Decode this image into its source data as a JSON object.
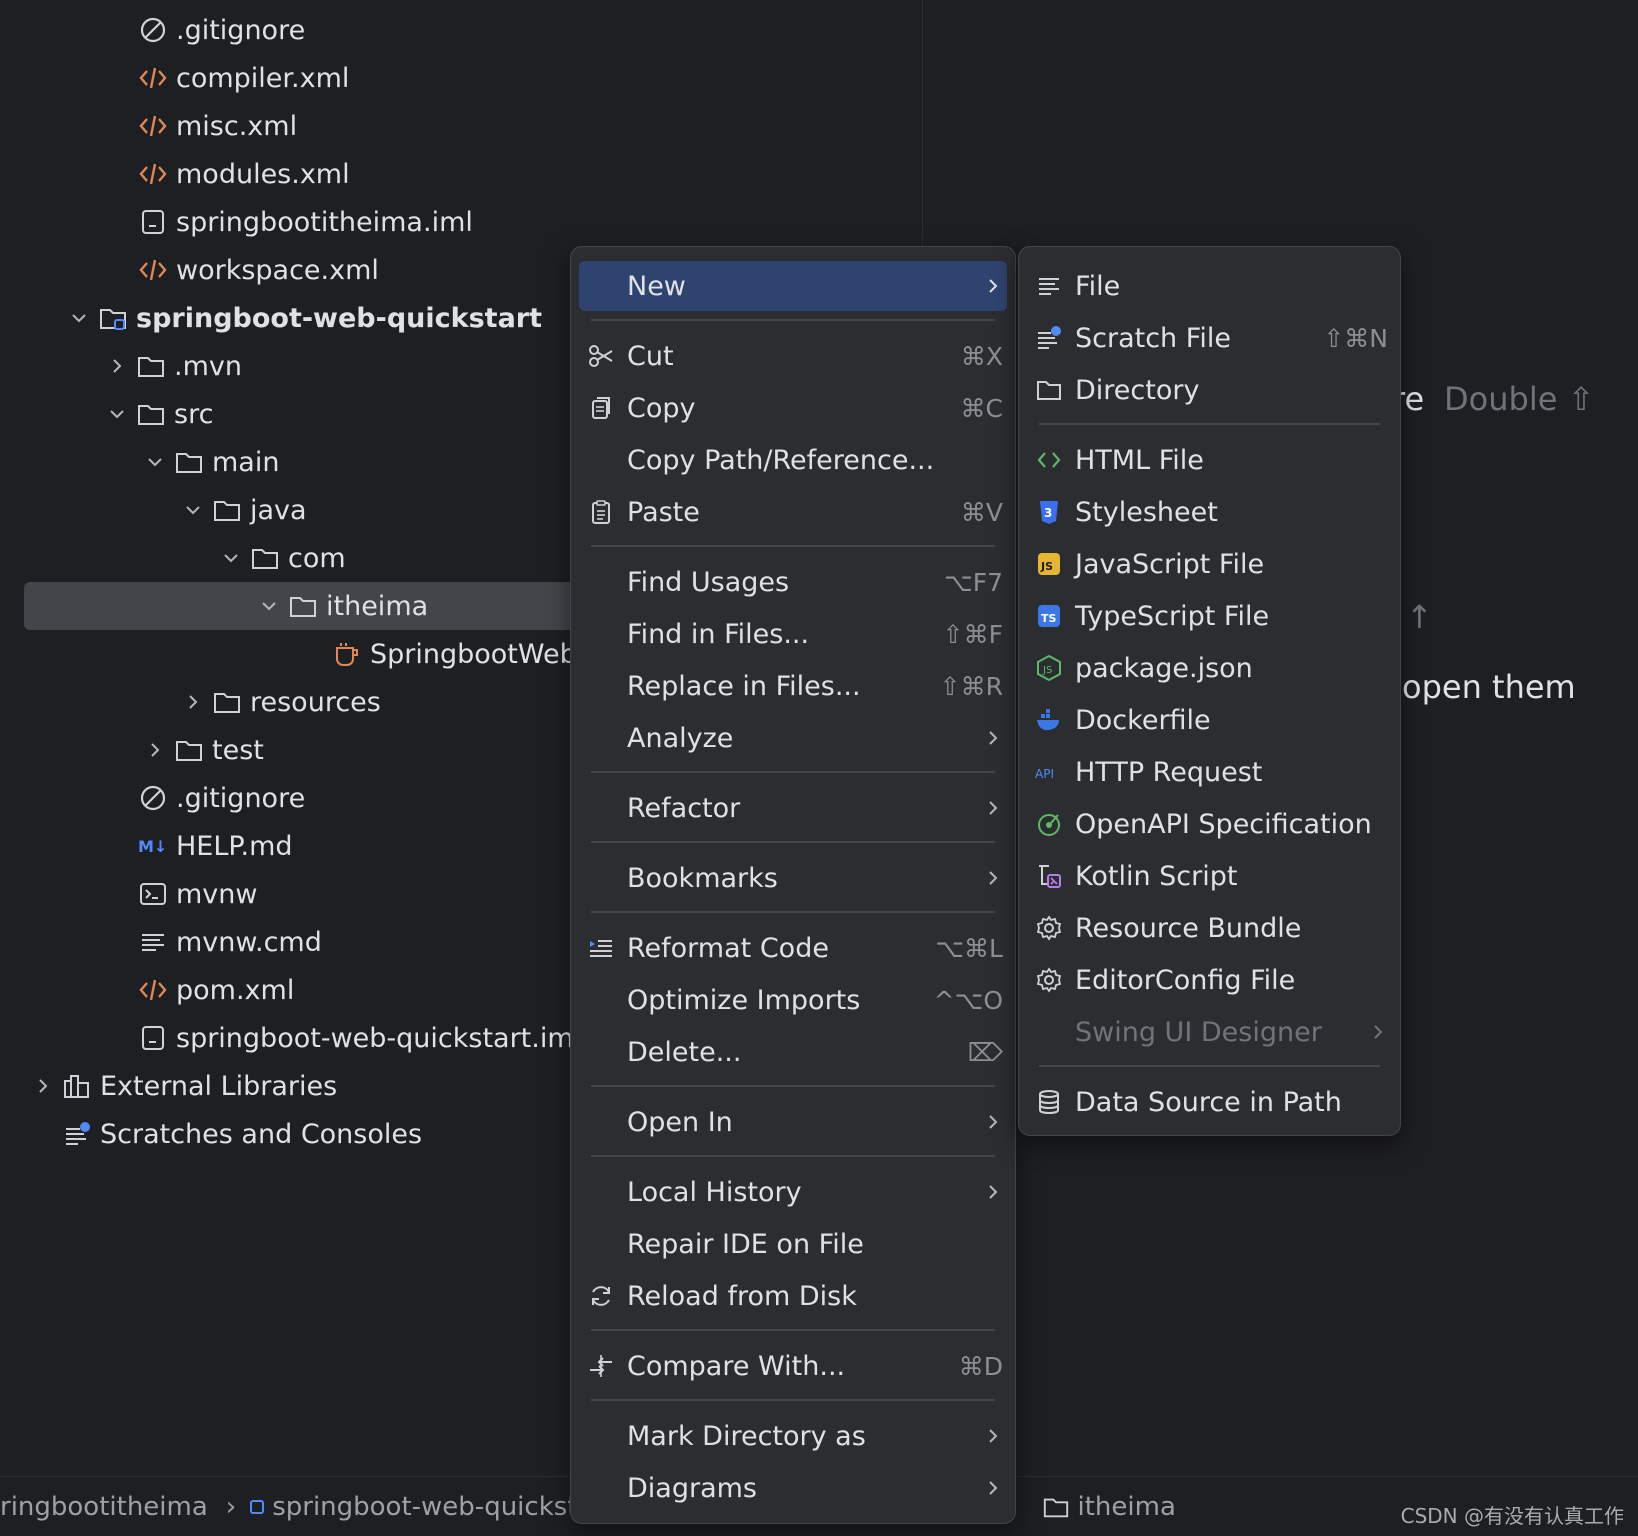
{
  "tree": [
    {
      "label": ".gitignore",
      "icon": "ignore-icon",
      "chevron": ""
    },
    {
      "label": "compiler.xml",
      "icon": "xml-icon",
      "chevron": ""
    },
    {
      "label": "misc.xml",
      "icon": "xml-icon",
      "chevron": ""
    },
    {
      "label": "modules.xml",
      "icon": "xml-icon",
      "chevron": ""
    },
    {
      "label": "springbootitheima.iml",
      "icon": "iml-icon",
      "chevron": ""
    },
    {
      "label": "workspace.xml",
      "icon": "xml-icon",
      "chevron": ""
    },
    {
      "label": "springboot-web-quickstart",
      "icon": "module-folder-icon",
      "chevron": "down"
    },
    {
      "label": ".mvn",
      "icon": "folder-icon",
      "chevron": "right"
    },
    {
      "label": "src",
      "icon": "folder-icon",
      "chevron": "down"
    },
    {
      "label": "main",
      "icon": "folder-icon",
      "chevron": "down"
    },
    {
      "label": "java",
      "icon": "folder-icon",
      "chevron": "down"
    },
    {
      "label": "com",
      "icon": "folder-icon",
      "chevron": "down"
    },
    {
      "label": "itheima",
      "icon": "folder-icon",
      "chevron": "down"
    },
    {
      "label": "SpringbootWebQ",
      "icon": "java-class-icon",
      "chevron": ""
    },
    {
      "label": "resources",
      "icon": "folder-icon",
      "chevron": "right"
    },
    {
      "label": "test",
      "icon": "folder-icon",
      "chevron": "right"
    },
    {
      "label": ".gitignore",
      "icon": "ignore-icon",
      "chevron": ""
    },
    {
      "label": "HELP.md",
      "icon": "markdown-icon",
      "chevron": ""
    },
    {
      "label": "mvnw",
      "icon": "terminal-icon",
      "chevron": ""
    },
    {
      "label": "mvnw.cmd",
      "icon": "text-file-icon",
      "chevron": ""
    },
    {
      "label": "pom.xml",
      "icon": "xml-icon",
      "chevron": ""
    },
    {
      "label": "springboot-web-quickstart.iml",
      "icon": "iml-icon",
      "chevron": ""
    },
    {
      "label": "External Libraries",
      "icon": "library-icon",
      "chevron": "right"
    },
    {
      "label": "Scratches and Consoles",
      "icon": "scratches-icon",
      "chevron": ""
    }
  ],
  "editor_hints": {
    "search_fragment": "re",
    "search_shortcut": "Double ⇧",
    "up_arrow": "↑",
    "open_fragment": "open them"
  },
  "context_menu": {
    "items": [
      {
        "label": "New",
        "shortcut": "",
        "icon": "",
        "submenu": true
      },
      {
        "label": "Cut",
        "shortcut": "⌘X",
        "icon": "scissors-icon",
        "submenu": false
      },
      {
        "label": "Copy",
        "shortcut": "⌘C",
        "icon": "copy-icon",
        "submenu": false
      },
      {
        "label": "Copy Path/Reference...",
        "shortcut": "",
        "icon": "",
        "submenu": false
      },
      {
        "label": "Paste",
        "shortcut": "⌘V",
        "icon": "clipboard-icon",
        "submenu": false
      },
      {
        "label": "Find Usages",
        "shortcut": "⌥F7",
        "icon": "",
        "submenu": false
      },
      {
        "label": "Find in Files...",
        "shortcut": "⇧⌘F",
        "icon": "",
        "submenu": false
      },
      {
        "label": "Replace in Files...",
        "shortcut": "⇧⌘R",
        "icon": "",
        "submenu": false
      },
      {
        "label": "Analyze",
        "shortcut": "",
        "icon": "",
        "submenu": true
      },
      {
        "label": "Refactor",
        "shortcut": "",
        "icon": "",
        "submenu": true
      },
      {
        "label": "Bookmarks",
        "shortcut": "",
        "icon": "",
        "submenu": true
      },
      {
        "label": "Reformat Code",
        "shortcut": "⌥⌘L",
        "icon": "reformat-icon",
        "submenu": false
      },
      {
        "label": "Optimize Imports",
        "shortcut": "^⌥O",
        "icon": "",
        "submenu": false
      },
      {
        "label": "Delete...",
        "shortcut": "⌦",
        "icon": "",
        "submenu": false
      },
      {
        "label": "Open In",
        "shortcut": "",
        "icon": "",
        "submenu": true
      },
      {
        "label": "Local History",
        "shortcut": "",
        "icon": "",
        "submenu": true
      },
      {
        "label": "Repair IDE on File",
        "shortcut": "",
        "icon": "",
        "submenu": false
      },
      {
        "label": "Reload from Disk",
        "shortcut": "",
        "icon": "reload-icon",
        "submenu": false
      },
      {
        "label": "Compare With...",
        "shortcut": "⌘D",
        "icon": "compare-icon",
        "submenu": false
      },
      {
        "label": "Mark Directory as",
        "shortcut": "",
        "icon": "",
        "submenu": true
      },
      {
        "label": "Diagrams",
        "shortcut": "",
        "icon": "",
        "submenu": true
      }
    ]
  },
  "new_submenu": {
    "items": [
      {
        "label": "File",
        "shortcut": "",
        "icon": "text-file-icon",
        "disabled": false
      },
      {
        "label": "Scratch File",
        "shortcut": "⇧⌘N",
        "icon": "scratch-file-icon",
        "disabled": false
      },
      {
        "label": "Directory",
        "shortcut": "",
        "icon": "folder-icon",
        "disabled": false
      },
      {
        "label": "HTML File",
        "shortcut": "",
        "icon": "html-icon",
        "disabled": false
      },
      {
        "label": "Stylesheet",
        "shortcut": "",
        "icon": "css-icon",
        "disabled": false
      },
      {
        "label": "JavaScript File",
        "shortcut": "",
        "icon": "js-icon",
        "disabled": false
      },
      {
        "label": "TypeScript File",
        "shortcut": "",
        "icon": "ts-icon",
        "disabled": false
      },
      {
        "label": "package.json",
        "shortcut": "",
        "icon": "nodejs-icon",
        "disabled": false
      },
      {
        "label": "Dockerfile",
        "shortcut": "",
        "icon": "docker-icon",
        "disabled": false
      },
      {
        "label": "HTTP Request",
        "shortcut": "",
        "icon": "api-icon",
        "disabled": false
      },
      {
        "label": "OpenAPI Specification",
        "shortcut": "",
        "icon": "openapi-icon",
        "disabled": false
      },
      {
        "label": "Kotlin Script",
        "shortcut": "",
        "icon": "kotlin-script-icon",
        "disabled": false
      },
      {
        "label": "Resource Bundle",
        "shortcut": "",
        "icon": "gear-icon",
        "disabled": false
      },
      {
        "label": "EditorConfig File",
        "shortcut": "",
        "icon": "gear-icon",
        "disabled": false
      },
      {
        "label": "Swing UI Designer",
        "shortcut": "",
        "icon": "",
        "disabled": true
      },
      {
        "label": "Data Source in Path",
        "shortcut": "",
        "icon": "database-icon",
        "disabled": false
      }
    ]
  },
  "status_bar": {
    "crumb_project": "ringbootitheima",
    "crumb_module": "springboot-web-quickst",
    "crumb_folder": "itheima"
  },
  "watermark": "CSDN @有没有认真工作",
  "colors": {
    "background": "#1e1f22",
    "menu_background": "#2b2d30",
    "highlight": "#2e436e",
    "selection": "#43454a",
    "xml_orange": "#e08855",
    "accent_blue": "#548af7"
  }
}
